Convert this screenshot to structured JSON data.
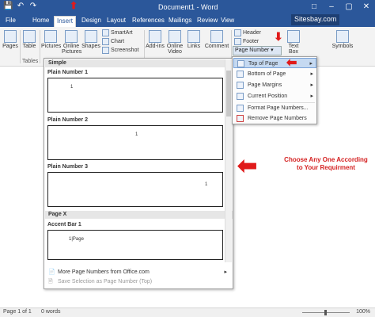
{
  "window": {
    "title": "Document1 - Word",
    "site_badge": "Sitesbay.com",
    "colors": {
      "brand": "#2b579a",
      "highlight": "#c5d9f1",
      "callout": "#d42020"
    }
  },
  "qat": {
    "save_icon": "save-icon",
    "undo_icon": "undo-icon",
    "redo_icon": "redo-icon"
  },
  "tabs": [
    "File",
    "Home",
    "Insert",
    "Design",
    "Layout",
    "References",
    "Mailings",
    "Review",
    "View"
  ],
  "ribbon": {
    "pages_label": "Pages",
    "table_label": "Table",
    "tables_group": "Tables",
    "pictures_label": "Pictures",
    "online_pictures_label": "Online Pictures",
    "shapes_label": "Shapes",
    "smartart_label": "SmartArt",
    "chart_label": "Chart",
    "screenshot_label": "Screenshot",
    "addins_label": "Add-ins",
    "online_video_label": "Online Video",
    "links_label": "Links",
    "comment_label": "Comment",
    "header_label": "Header",
    "footer_label": "Footer",
    "page_number_label": "Page Number",
    "textbox_label": "Text Box",
    "symbols_label": "Symbols"
  },
  "gallery": {
    "section_simple": "Simple",
    "items": [
      {
        "label": "Plain Number 1"
      },
      {
        "label": "Plain Number 2"
      },
      {
        "label": "Plain Number 3"
      }
    ],
    "section_pagex": "Page X",
    "accent_label": "Accent Bar 1",
    "accent_preview_text": "1|Page",
    "more_numbers": "More Page Numbers from Office.com",
    "save_selection": "Save Selection as Page Number (Top)"
  },
  "page_number_menu": {
    "items": [
      {
        "label": "Top of Page",
        "has_submenu": true
      },
      {
        "label": "Bottom of Page",
        "has_submenu": true
      },
      {
        "label": "Page Margins",
        "has_submenu": true
      },
      {
        "label": "Current Position",
        "has_submenu": true
      },
      {
        "label": "Format Page Numbers...",
        "has_submenu": false
      },
      {
        "label": "Remove Page Numbers",
        "has_submenu": false
      }
    ]
  },
  "callout": {
    "line1": "Choose Any One According",
    "line2": "to Your Requirment"
  },
  "status": {
    "page": "Page 1 of 1",
    "words": "0 words",
    "zoom": "100%"
  }
}
